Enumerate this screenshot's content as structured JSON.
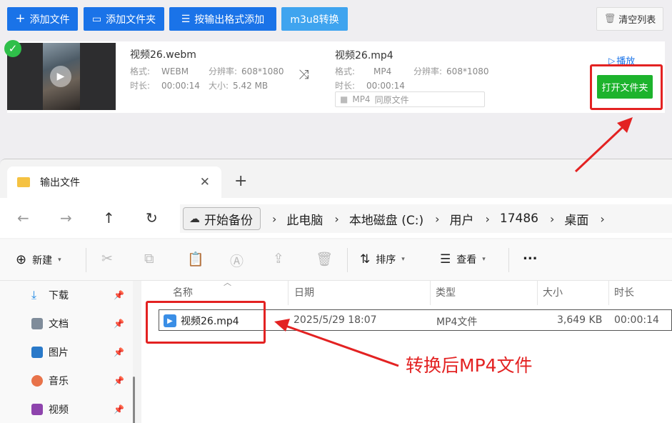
{
  "converter": {
    "toolbar": {
      "add_file": "添加文件",
      "add_folder": "添加文件夹",
      "add_by_format": "按输出格式添加",
      "m3u8_convert": "m3u8转换",
      "clear_list": "清空列表"
    },
    "source": {
      "filename": "视频26.webm",
      "format_label": "格式:",
      "format_value": "WEBM",
      "resolution_label": "分辨率:",
      "resolution_value": "608*1080",
      "duration_label": "时长:",
      "duration_value": "00:00:14",
      "size_label": "大小:",
      "size_value": "5.42 MB"
    },
    "output": {
      "filename": "视频26.mp4",
      "format_label": "格式:",
      "format_value": "MP4",
      "resolution_label": "分辨率:",
      "resolution_value": "608*1080",
      "duration_label": "时长:",
      "duration_value": "00:00:14",
      "select_format": "MP4",
      "select_option": "同原文件"
    },
    "play_label": "播放",
    "open_folder_label": "打开文件夹"
  },
  "explorer": {
    "tab_title": "输出文件",
    "breadcrumb": {
      "backup": "开始备份",
      "items": [
        "此电脑",
        "本地磁盘 (C:)",
        "用户",
        "17486",
        "桌面"
      ]
    },
    "commands": {
      "new": "新建",
      "sort": "排序",
      "view": "查看",
      "more": "..."
    },
    "sidebar": [
      {
        "label": "下载",
        "icon": "download-icon",
        "color": "#1e88e5"
      },
      {
        "label": "文档",
        "icon": "document-icon",
        "color": "#7f8c9a"
      },
      {
        "label": "图片",
        "icon": "pictures-icon",
        "color": "#2979c9"
      },
      {
        "label": "音乐",
        "icon": "music-icon",
        "color": "#e8734a"
      },
      {
        "label": "视频",
        "icon": "video-icon",
        "color": "#8e44ad"
      }
    ],
    "columns": {
      "name": "名称",
      "date": "日期",
      "type": "类型",
      "size": "大小",
      "duration": "时长"
    },
    "file": {
      "name": "视频26.mp4",
      "date": "2025/5/29 18:07",
      "type": "MP4文件",
      "size": "3,649 KB",
      "duration": "00:00:14"
    }
  },
  "annotation": {
    "text": "转换后MP4文件",
    "color": "#e32222"
  }
}
